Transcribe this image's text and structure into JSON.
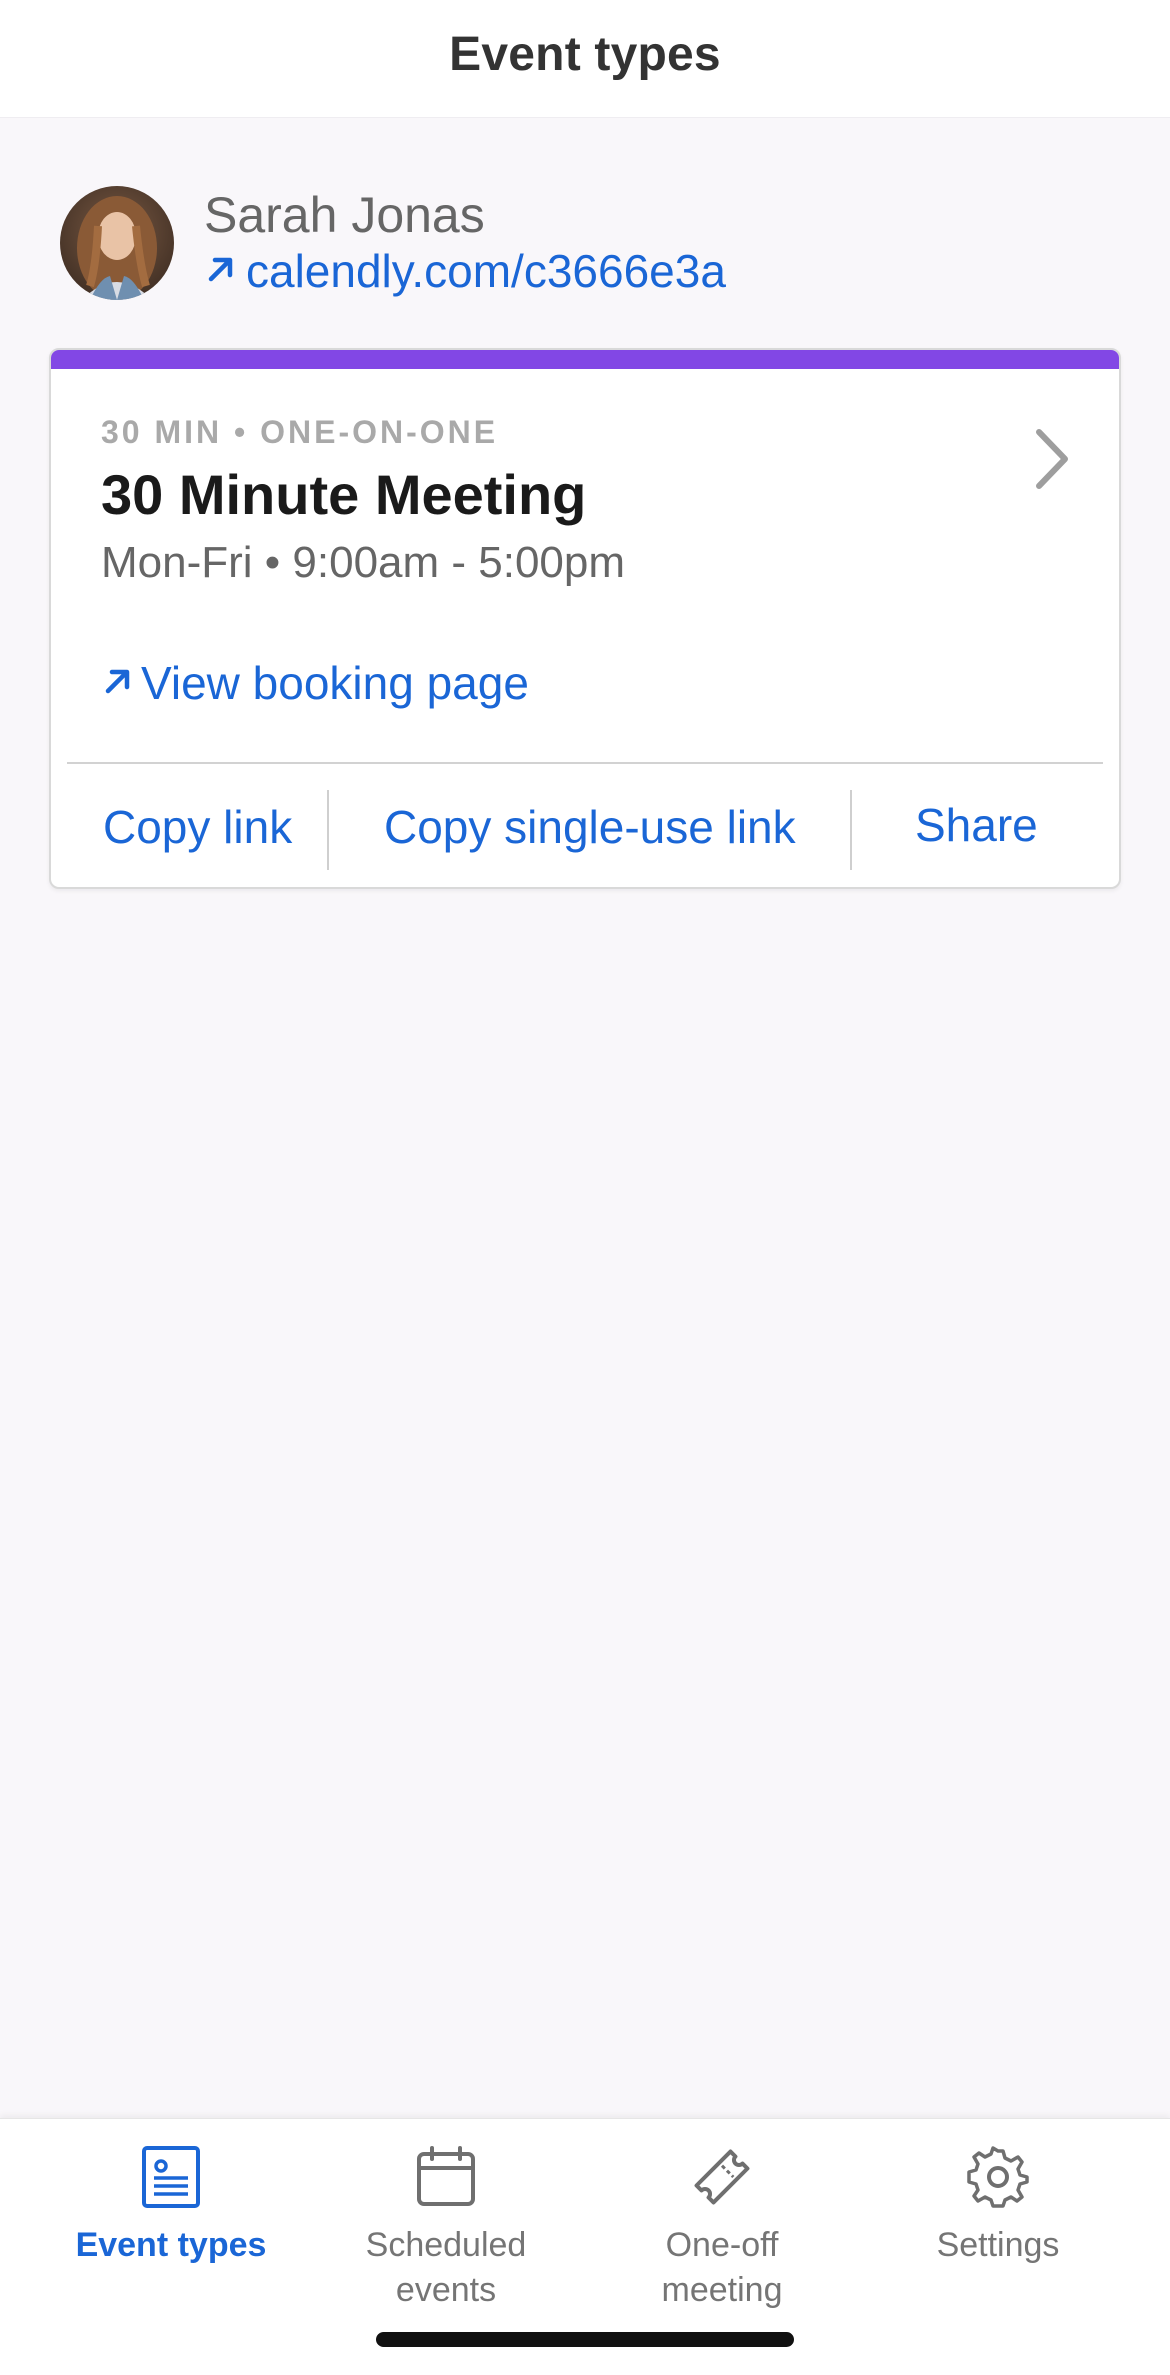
{
  "header": {
    "title": "Event types"
  },
  "profile": {
    "name": "Sarah Jonas",
    "link_icon": "arrow-up-right-icon",
    "link": "calendly.com/c3666e3a"
  },
  "event_card": {
    "accent_color": "#8247e5",
    "meta": "30 MIN • ONE-ON-ONE",
    "title": "30 Minute Meeting",
    "schedule": "Mon-Fri • 9:00am - 5:00pm",
    "view_booking_label": "View booking page",
    "actions": {
      "copy_link": "Copy link",
      "copy_single_use_link": "Copy single-use link",
      "share": "Share"
    }
  },
  "bottom_nav": {
    "items": [
      {
        "label": "Event types",
        "icon": "event-types-icon",
        "active": true
      },
      {
        "label": "Scheduled events",
        "icon": "calendar-icon",
        "active": false
      },
      {
        "label": "One-off meeting",
        "icon": "ticket-icon",
        "active": false
      },
      {
        "label": "Settings",
        "icon": "gear-icon",
        "active": false
      }
    ]
  },
  "colors": {
    "link_blue": "#1a66d6",
    "accent_purple": "#8247e5",
    "background": "#f9f7fa"
  }
}
